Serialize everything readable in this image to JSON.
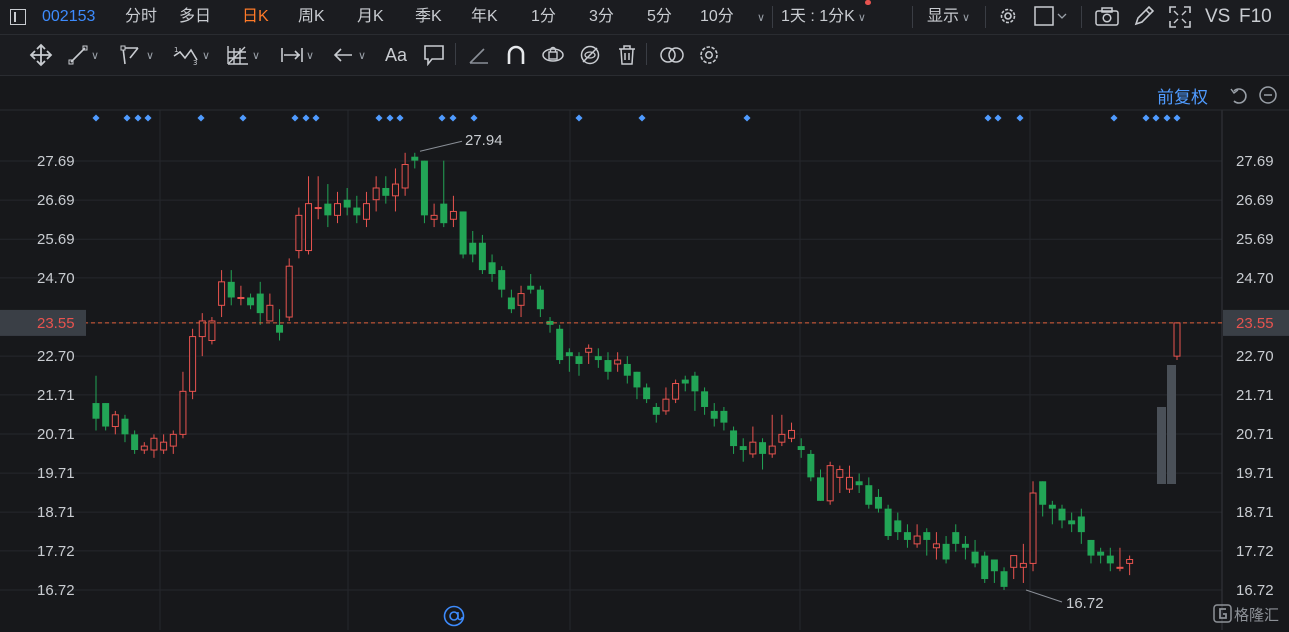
{
  "header": {
    "stock_code": "002153",
    "periods": [
      {
        "label": "分时",
        "active": false
      },
      {
        "label": "多日",
        "active": false
      },
      {
        "label": "日K",
        "active": true
      },
      {
        "label": "周K",
        "active": false
      },
      {
        "label": "月K",
        "active": false
      },
      {
        "label": "季K",
        "active": false
      },
      {
        "label": "年K",
        "active": false
      },
      {
        "label": "1分",
        "active": false
      },
      {
        "label": "3分",
        "active": false
      },
      {
        "label": "5分",
        "active": false
      },
      {
        "label": "10分",
        "active": false
      }
    ],
    "interval_select": "1天 : 1分K",
    "display_label": "显示",
    "vs_label": "VS",
    "f10_label": "F10"
  },
  "toolbar": {
    "font_label": "Aa"
  },
  "chart_label": {
    "adjust_mode": "前复权"
  },
  "colors": {
    "up": "#e8534f",
    "down": "#22a556",
    "accent": "#ff7a28",
    "link": "#4f9bff",
    "price_line": "#e0603a"
  },
  "chart_data": {
    "type": "candlestick",
    "y_ticks": [
      "27.69",
      "26.69",
      "25.69",
      "24.70",
      "23.55",
      "22.70",
      "21.71",
      "20.71",
      "19.71",
      "18.71",
      "17.72",
      "16.72"
    ],
    "ylim": [
      16.2,
      28.8
    ],
    "current_price": 23.55,
    "high_label": "27.94",
    "low_label": "16.72",
    "high": 27.94,
    "low": 16.72,
    "candles": [
      [
        21.5,
        21.1,
        22.2,
        20.8
      ],
      [
        21.5,
        20.9,
        21.5,
        20.8
      ],
      [
        20.9,
        21.2,
        21.3,
        20.7
      ],
      [
        21.1,
        20.7,
        21.2,
        20.5
      ],
      [
        20.7,
        20.3,
        20.8,
        20.2
      ],
      [
        20.3,
        20.4,
        20.5,
        20.2
      ],
      [
        20.3,
        20.6,
        20.7,
        20.1
      ],
      [
        20.3,
        20.5,
        20.7,
        20.2
      ],
      [
        20.4,
        20.7,
        20.8,
        20.2
      ],
      [
        20.7,
        21.8,
        22.3,
        20.6
      ],
      [
        21.8,
        23.2,
        23.4,
        21.6
      ],
      [
        23.2,
        23.6,
        23.8,
        22.7
      ],
      [
        23.1,
        23.6,
        23.7,
        23.0
      ],
      [
        24.0,
        24.6,
        24.9,
        23.7
      ],
      [
        24.6,
        24.2,
        24.9,
        24.0
      ],
      [
        24.2,
        24.2,
        24.5,
        24.0
      ],
      [
        24.2,
        24.0,
        24.3,
        23.9
      ],
      [
        24.3,
        23.8,
        24.6,
        23.5
      ],
      [
        23.6,
        24.0,
        24.3,
        23.6
      ],
      [
        23.5,
        23.3,
        23.9,
        23.1
      ],
      [
        23.7,
        25.0,
        25.2,
        23.6
      ],
      [
        25.4,
        26.3,
        26.5,
        25.2
      ],
      [
        25.4,
        26.6,
        27.3,
        25.3
      ],
      [
        26.5,
        26.5,
        27.3,
        26.2
      ],
      [
        26.6,
        26.3,
        27.1,
        26.0
      ],
      [
        26.3,
        26.6,
        26.9,
        26.1
      ],
      [
        26.7,
        26.5,
        27.0,
        26.3
      ],
      [
        26.5,
        26.3,
        26.8,
        26.1
      ],
      [
        26.2,
        26.6,
        26.9,
        26.0
      ],
      [
        26.7,
        27.0,
        27.3,
        26.4
      ],
      [
        27.0,
        26.8,
        27.3,
        26.6
      ],
      [
        26.8,
        27.1,
        27.5,
        26.4
      ],
      [
        27.0,
        27.6,
        27.9,
        26.8
      ],
      [
        27.8,
        27.7,
        27.9,
        27.5
      ],
      [
        27.7,
        26.3,
        27.7,
        26.1
      ],
      [
        26.2,
        26.3,
        26.6,
        26.0
      ],
      [
        26.6,
        26.1,
        27.7,
        26.0
      ],
      [
        26.2,
        26.4,
        26.8,
        26.0
      ],
      [
        26.4,
        25.3,
        26.4,
        25.2
      ],
      [
        25.6,
        25.3,
        25.9,
        25.1
      ],
      [
        25.6,
        24.9,
        25.8,
        24.8
      ],
      [
        25.1,
        24.8,
        25.3,
        24.6
      ],
      [
        24.9,
        24.4,
        25.0,
        24.2
      ],
      [
        24.2,
        23.9,
        24.4,
        23.8
      ],
      [
        24.0,
        24.3,
        24.5,
        23.7
      ],
      [
        24.5,
        24.4,
        24.8,
        24.3
      ],
      [
        24.4,
        23.9,
        24.5,
        23.7
      ],
      [
        23.6,
        23.5,
        23.7,
        23.3
      ],
      [
        23.4,
        22.6,
        23.5,
        22.5
      ],
      [
        22.8,
        22.7,
        22.9,
        22.3
      ],
      [
        22.7,
        22.5,
        22.8,
        22.2
      ],
      [
        22.8,
        22.9,
        23.0,
        22.5
      ],
      [
        22.7,
        22.6,
        22.9,
        22.4
      ],
      [
        22.6,
        22.3,
        22.8,
        22.1
      ],
      [
        22.5,
        22.6,
        22.8,
        22.3
      ],
      [
        22.5,
        22.2,
        22.7,
        22.0
      ],
      [
        22.3,
        21.9,
        22.3,
        21.6
      ],
      [
        21.9,
        21.6,
        22.0,
        21.5
      ],
      [
        21.4,
        21.2,
        21.5,
        21.0
      ],
      [
        21.3,
        21.6,
        21.9,
        21.2
      ],
      [
        21.6,
        22.0,
        22.1,
        21.5
      ],
      [
        22.1,
        22.0,
        22.2,
        21.8
      ],
      [
        22.2,
        21.8,
        22.3,
        21.3
      ],
      [
        21.8,
        21.4,
        21.9,
        21.2
      ],
      [
        21.3,
        21.1,
        21.5,
        20.9
      ],
      [
        21.3,
        21.0,
        21.4,
        20.8
      ],
      [
        20.8,
        20.4,
        20.9,
        20.2
      ],
      [
        20.4,
        20.3,
        20.6,
        20.0
      ],
      [
        20.2,
        20.5,
        20.9,
        20.1
      ],
      [
        20.5,
        20.2,
        20.6,
        19.8
      ],
      [
        20.2,
        20.4,
        21.2,
        20.1
      ],
      [
        20.5,
        20.7,
        21.2,
        20.4
      ],
      [
        20.6,
        20.8,
        21.0,
        20.5
      ],
      [
        20.4,
        20.3,
        20.6,
        20.1
      ],
      [
        20.2,
        19.6,
        20.3,
        19.5
      ],
      [
        19.6,
        19.0,
        19.8,
        19.0
      ],
      [
        19.0,
        19.9,
        20.0,
        18.9
      ],
      [
        19.6,
        19.8,
        19.9,
        19.2
      ],
      [
        19.3,
        19.6,
        19.9,
        19.2
      ],
      [
        19.5,
        19.4,
        19.7,
        19.2
      ],
      [
        19.4,
        18.9,
        19.6,
        18.8
      ],
      [
        19.1,
        18.8,
        19.3,
        18.7
      ],
      [
        18.8,
        18.1,
        18.9,
        18.0
      ],
      [
        18.5,
        18.2,
        18.7,
        18.0
      ],
      [
        18.2,
        18.0,
        18.4,
        17.8
      ],
      [
        17.9,
        18.1,
        18.4,
        17.8
      ],
      [
        18.2,
        18.0,
        18.3,
        17.6
      ],
      [
        17.8,
        17.9,
        18.2,
        17.5
      ],
      [
        17.9,
        17.5,
        18.1,
        17.4
      ],
      [
        18.2,
        17.9,
        18.4,
        17.7
      ],
      [
        17.9,
        17.8,
        18.1,
        17.5
      ],
      [
        17.7,
        17.4,
        18.0,
        17.3
      ],
      [
        17.6,
        17.0,
        17.7,
        16.9
      ],
      [
        17.5,
        17.2,
        17.5,
        16.9
      ],
      [
        17.2,
        16.8,
        17.3,
        16.72
      ],
      [
        17.3,
        17.6,
        17.6,
        17.0
      ],
      [
        17.3,
        17.4,
        17.9,
        16.9
      ],
      [
        17.4,
        19.2,
        19.5,
        17.2
      ],
      [
        19.5,
        18.9,
        19.5,
        18.6
      ],
      [
        18.9,
        18.8,
        19.0,
        18.4
      ],
      [
        18.8,
        18.5,
        18.9,
        18.3
      ],
      [
        18.5,
        18.4,
        18.7,
        18.2
      ],
      [
        18.6,
        18.2,
        18.8,
        17.9
      ],
      [
        18.0,
        17.6,
        18.0,
        17.4
      ],
      [
        17.7,
        17.6,
        17.8,
        17.4
      ],
      [
        17.6,
        17.4,
        17.8,
        17.2
      ],
      [
        17.3,
        17.3,
        17.8,
        17.2
      ],
      [
        17.4,
        17.5,
        17.6,
        17.1
      ]
    ],
    "today_candle": [
      22.7,
      23.55,
      23.55,
      22.6
    ],
    "volume_bars": [
      [
        1157,
        407,
        1166,
        484
      ],
      [
        1167,
        365,
        1176,
        484
      ]
    ]
  }
}
